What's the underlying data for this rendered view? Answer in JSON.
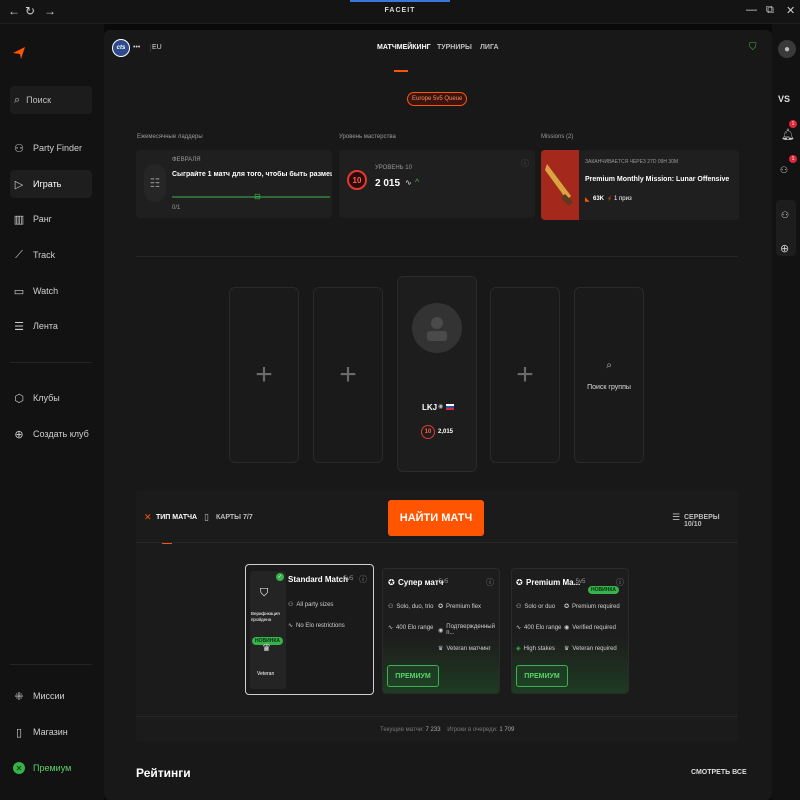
{
  "topbar": {
    "title": "FACEIT"
  },
  "sidebar": {
    "search": "Поиск",
    "items": [
      {
        "label": "Party Finder",
        "icon": "party-finder-icon"
      },
      {
        "label": "Играть",
        "icon": "play-icon"
      },
      {
        "label": "Ранг",
        "icon": "rank-icon"
      },
      {
        "label": "Track",
        "icon": "track-icon"
      },
      {
        "label": "Watch",
        "icon": "watch-icon"
      },
      {
        "label": "Лента",
        "icon": "feed-icon"
      }
    ],
    "clubs": [
      {
        "label": "Клубы",
        "icon": "clubs-icon"
      },
      {
        "label": "Создать клуб",
        "icon": "create-club-icon"
      }
    ],
    "bottom": [
      {
        "label": "Миссии",
        "icon": "missions-icon"
      },
      {
        "label": "Магазин",
        "icon": "shop-icon"
      },
      {
        "label": "Премиум",
        "icon": "premium-icon"
      }
    ]
  },
  "header": {
    "game_badge": "cts",
    "more": "•••",
    "region": "EU",
    "tabs": [
      "МАТЧМЕЙКИНГ",
      "ТУРНИРЫ",
      "ЛИГА"
    ],
    "queue_label": "Europe 5v5 Queue"
  },
  "cards": {
    "ladders": {
      "section": "Ежемесячные ладдеры",
      "month": "ФЕВРАЛЯ",
      "text": "Сыграйте 1 матч для того, чтобы быть размещен",
      "progress": "0/1"
    },
    "mastery": {
      "section": "Уровень мастерства",
      "level_label": "УРОВЕНЬ 10",
      "level": "10",
      "elo": "2 015"
    },
    "missions": {
      "section": "Missions (2)",
      "ends": "ЗАКАНЧИВАЕТСЯ ЧЕРЕЗ 27D 09H 30M",
      "title": "Premium Monthly Mission: Lunar Offensive",
      "points": "63K",
      "prize": "1 приз"
    }
  },
  "lobby": {
    "player_name": "LKJ",
    "player_level": "10",
    "player_elo": "2,015",
    "search_group": "Поиск группы"
  },
  "controls": {
    "match_type": "ТИП МАТЧА",
    "maps": "КАРТЫ 7/7",
    "find_match": "НАЙТИ МАТЧ",
    "servers": "СЕРВЕРЫ 10/10"
  },
  "modes": {
    "standard": {
      "name": "Standard Match",
      "format": "· 5v5",
      "features": [
        "All party sizes",
        "No Elo restrictions"
      ],
      "side_label": "Верификация пройдена",
      "side_badge": "НОВИНКА",
      "side_rank": "Veteran"
    },
    "super": {
      "name": "Супер матч",
      "format": "· 5v5",
      "features": [
        "Solo, duo, trio",
        "Premium flex",
        "400 Elo range",
        "Подтвержденный п...",
        "Veteran матчинг"
      ],
      "button": "ПРЕМИУМ"
    },
    "premium": {
      "name": "Premium Ma...",
      "format": "· 5v5",
      "badge": "НОВИНКА",
      "features": [
        "Solo or duo",
        "Premium required",
        "400 Elo range",
        "Verified required",
        "High stakes",
        "Veteran required"
      ],
      "button": "ПРЕМИУМ"
    }
  },
  "status": {
    "current_matches_label": "Текущие матчи:",
    "current_matches": "7 233",
    "queue_label": "Игроки в очереди:",
    "queue": "1 709"
  },
  "ratings": {
    "title": "Рейтинги",
    "see_all": "СМОТРЕТЬ ВСЕ"
  },
  "rightrail": {
    "vs": "VS",
    "notif_count": "1",
    "friends_count": "1"
  },
  "colors": {
    "accent": "#ff5500",
    "premium_green": "#3fb052",
    "bg": "#181818"
  }
}
